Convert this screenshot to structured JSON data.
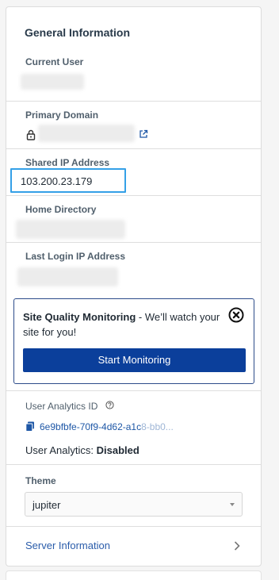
{
  "panel": {
    "title": "General Information",
    "current_user": {
      "label": "Current User"
    },
    "primary_domain": {
      "label": "Primary Domain"
    },
    "shared_ip": {
      "label": "Shared IP Address",
      "value": "103.200.23.179"
    },
    "home_directory": {
      "label": "Home Directory"
    },
    "last_login_ip": {
      "label": "Last Login IP Address"
    },
    "monitoring": {
      "title": "Site Quality Monitoring",
      "message": " - We’ll watch your site for you!",
      "button_label": "Start Monitoring"
    },
    "user_analytics": {
      "label": "User Analytics ID",
      "id_visible": "6e9bfbfe-70f9-4d62-a1c",
      "id_faded": "8-bb0...",
      "status_label": "User Analytics:",
      "status_value": "Disabled"
    },
    "theme": {
      "label": "Theme",
      "selected": "jupiter"
    },
    "server_information": {
      "label": "Server Information"
    }
  },
  "icons": {
    "lock": "lock-icon",
    "external_link": "external-link-icon",
    "close": "close-circle-icon",
    "help": "help-circle-icon",
    "copy": "copy-icon",
    "chevron": "chevron-right-icon"
  },
  "colors": {
    "accent_button": "#0b3f9b",
    "highlight_border": "#34a0e7",
    "link": "#1e57a6"
  }
}
